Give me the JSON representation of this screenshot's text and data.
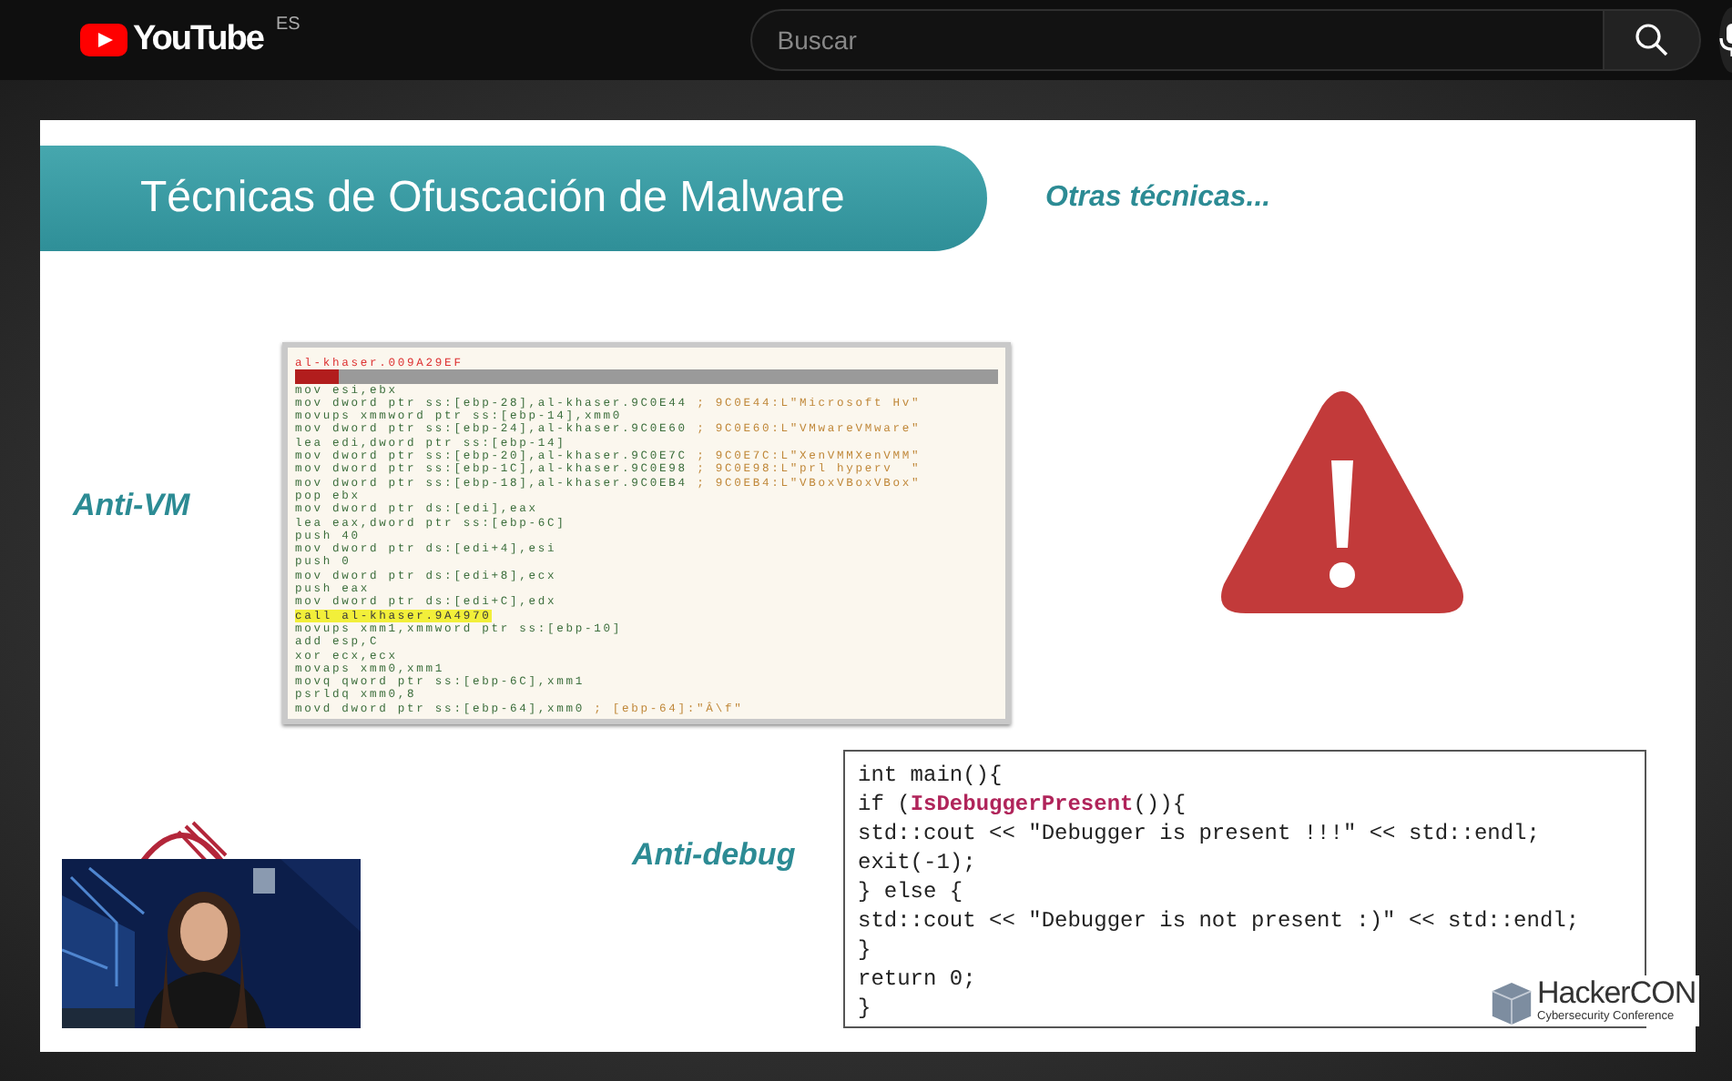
{
  "header": {
    "logo_text": "YouTube",
    "country": "ES",
    "search": {
      "placeholder": "Buscar"
    }
  },
  "slide": {
    "title": "Técnicas de Ofuscación de Malware",
    "subtitle": "Otras técnicas...",
    "sections": [
      {
        "label": "Anti-VM"
      },
      {
        "label": "Anti-debug"
      }
    ],
    "disassembly": {
      "lines": [
        {
          "kind": "header",
          "text": "al-khaser.009A29EF"
        },
        {
          "kind": "selection"
        },
        {
          "kind": "code",
          "text": "mov esi,ebx"
        },
        {
          "kind": "code",
          "text": "mov dword ptr ss:[ebp-28],al-khaser.9C0E44",
          "comment": "; 9C0E44:L\"Microsoft Hv\""
        },
        {
          "kind": "code",
          "text": "movups xmmword ptr ss:[ebp-14],xmm0"
        },
        {
          "kind": "code",
          "text": "mov dword ptr ss:[ebp-24],al-khaser.9C0E60",
          "comment": "; 9C0E60:L\"VMwareVMware\""
        },
        {
          "kind": "code",
          "text": "lea edi,dword ptr ss:[ebp-14]"
        },
        {
          "kind": "code",
          "text": "mov dword ptr ss:[ebp-20],al-khaser.9C0E7C",
          "comment": "; 9C0E7C:L\"XenVMMXenVMM\""
        },
        {
          "kind": "code",
          "text": "mov dword ptr ss:[ebp-1C],al-khaser.9C0E98",
          "comment": "; 9C0E98:L\"prl hyperv  \""
        },
        {
          "kind": "code",
          "text": "mov dword ptr ss:[ebp-18],al-khaser.9C0EB4",
          "comment": "; 9C0EB4:L\"VBoxVBoxVBox\""
        },
        {
          "kind": "code",
          "text": "pop ebx"
        },
        {
          "kind": "code",
          "text": "mov dword ptr ds:[edi],eax"
        },
        {
          "kind": "code",
          "text": "lea eax,dword ptr ss:[ebp-6C]"
        },
        {
          "kind": "code",
          "text": "push 40"
        },
        {
          "kind": "code",
          "text": "mov dword ptr ds:[edi+4],esi"
        },
        {
          "kind": "code",
          "text": "push 0"
        },
        {
          "kind": "code",
          "text": "mov dword ptr ds:[edi+8],ecx"
        },
        {
          "kind": "code",
          "text": "push eax"
        },
        {
          "kind": "code",
          "text": "mov dword ptr ds:[edi+C],edx"
        },
        {
          "kind": "call",
          "text": "call al-khaser.9A4970"
        },
        {
          "kind": "code",
          "text": "movups xmm1,xmmword ptr ss:[ebp-10]"
        },
        {
          "kind": "code",
          "text": "add esp,C"
        },
        {
          "kind": "code",
          "text": "xor ecx,ecx"
        },
        {
          "kind": "code",
          "text": "movaps xmm0,xmm1"
        },
        {
          "kind": "code",
          "text": "movq qword ptr ss:[ebp-6C],xmm1"
        },
        {
          "kind": "code",
          "text": "psrldq xmm0,8"
        },
        {
          "kind": "code",
          "text": "movd dword ptr ss:[ebp-64],xmm0",
          "comment": "; [ebp-64]:\"Â\\f\""
        }
      ]
    },
    "code": {
      "lines": [
        "int main(){",
        "if (**IsDebuggerPresent**()){",
        "std::cout << \"Debugger is present !!!\" << std::endl;",
        "exit(-1);",
        "} else {",
        "std::cout << \"Debugger is not present :)\" << std::endl;",
        "}",
        "return 0;",
        "}"
      ]
    },
    "logo": {
      "name": "HackerCON",
      "tagline": "Cybersecurity Conference"
    }
  }
}
